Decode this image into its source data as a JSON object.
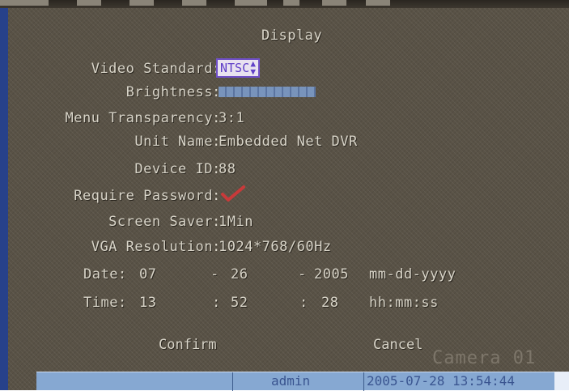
{
  "screen": {
    "title": "Display",
    "fields": {
      "video_standard": {
        "label": "Video Standard",
        "value": "NTSC"
      },
      "brightness": {
        "label": "Brightness"
      },
      "menu_transparency": {
        "label": "Menu Transparency",
        "value": "3:1"
      },
      "unit_name": {
        "label": "Unit Name",
        "value": "Embedded Net DVR"
      },
      "device_id": {
        "label": "Device ID",
        "value": "88"
      },
      "require_password": {
        "label": "Require Password",
        "checked": true
      },
      "screen_saver": {
        "label": "Screen Saver",
        "value": "1Min"
      },
      "vga_resolution": {
        "label": "VGA Resolution",
        "value": "1024*768/60Hz"
      }
    },
    "date": {
      "label": "Date:",
      "month": "07",
      "sep1": "-",
      "day": "26",
      "sep2": "-",
      "year": "2005",
      "format": "mm-dd-yyyy"
    },
    "time": {
      "label": "Time:",
      "hour": "13",
      "sep1": ":",
      "minute": "52",
      "sep2": ":",
      "second": "28",
      "format": "hh:mm:ss"
    },
    "buttons": {
      "confirm": "Confirm",
      "cancel": "Cancel"
    },
    "watermark": "Camera 01"
  },
  "status_bar": {
    "user": "admin",
    "datetime": "2005-07-28 13:54:44"
  },
  "colors": {
    "background": "#595246",
    "text": "#d8d4c8",
    "status_bar": "#86a8d2",
    "check": "#c83a3a",
    "selected_box_border": "#7050c8"
  },
  "icons": {
    "check": "checkmark-icon",
    "updown": "up-down-arrows-icon"
  }
}
